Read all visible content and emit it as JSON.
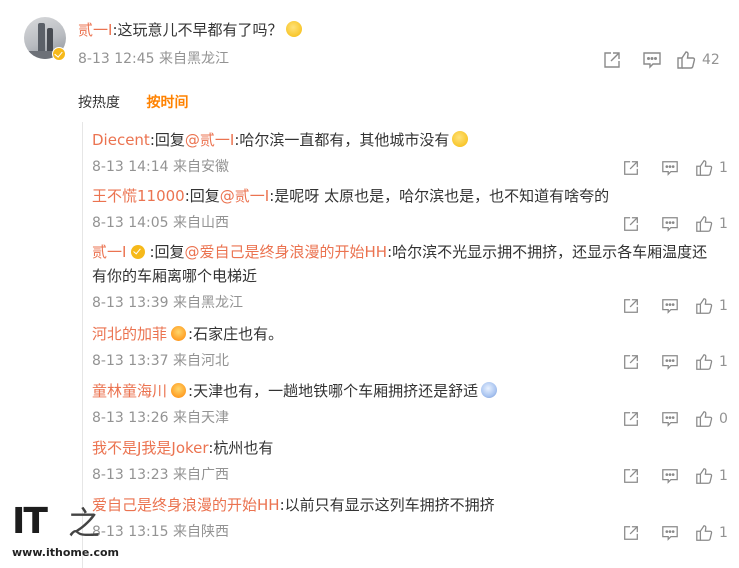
{
  "main_comment": {
    "author": "贰一I",
    "text": "这玩意儿不早都有了吗？",
    "date": "8-13 12:45",
    "location": "来自黑龙江",
    "likes": "42"
  },
  "sort": {
    "options": [
      "按热度",
      "按时间"
    ],
    "active": "按时间"
  },
  "replies": [
    {
      "author": "Diecent",
      "verb": "回复",
      "target": "@贰一I",
      "body": "哈尔滨一直都有，其他城市没有",
      "date": "8-13 14:14",
      "location": "来自安徽",
      "likes": "1"
    },
    {
      "author": "王不慌11000",
      "verb": "回复",
      "target": "@贰一I",
      "body": "是呢呀 太原也是，哈尔滨也是，也不知道有啥夸的",
      "date": "8-13 14:05",
      "location": "来自山西",
      "likes": "1"
    },
    {
      "author": "贰一I",
      "verb": "回复",
      "target": "@爱自己是终身浪漫的开始HH",
      "body": "哈尔滨不光显示拥不拥挤，还显示各车厢温度还有你的车厢离哪个电梯近",
      "date": "8-13 13:39",
      "location": "来自黑龙江",
      "likes": "1"
    },
    {
      "author": "河北的加菲",
      "body": "石家庄也有。",
      "date": "8-13 13:37",
      "location": "来自河北",
      "likes": "1"
    },
    {
      "author": "童林童海川",
      "body": "天津也有，一趟地铁哪个车厢拥挤还是舒适",
      "date": "8-13 13:26",
      "location": "来自天津",
      "likes": "0"
    },
    {
      "author": "我不是J我是Joker",
      "body": "杭州也有",
      "date": "8-13 13:23",
      "location": "来自广西",
      "likes": "1"
    },
    {
      "author": "爱自己是终身浪漫的开始HH",
      "body": "以前只有显示这列车拥挤不拥挤",
      "date": "8-13 13:15",
      "location": "来自陕西",
      "likes": "1"
    }
  ],
  "watermark": {
    "logo": "IT之家",
    "url": "www.ithome.com"
  },
  "colors": {
    "username": "#eb7350",
    "active_sort": "#ff8200",
    "meta": "#939393"
  },
  "icons": [
    "share-icon",
    "comment-icon",
    "like-icon",
    "verified-badge-icon",
    "vip-crown-icon"
  ]
}
